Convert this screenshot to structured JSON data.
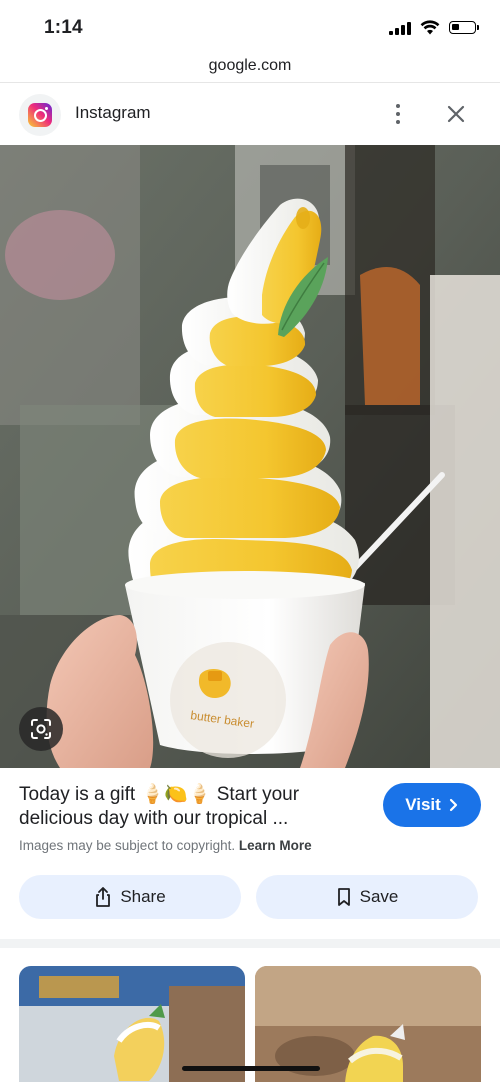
{
  "status_bar": {
    "time": "1:14",
    "battery_level": 0.35
  },
  "browser": {
    "url": "google.com"
  },
  "source": {
    "name": "Instagram",
    "logo_icon": "instagram-icon"
  },
  "result": {
    "title": "Today is a gift 🍦🍋🍦 Start your delicious day with our tropical ...",
    "visit_label": "Visit",
    "copyright_text": "Images may be subject to copyright.",
    "learn_more_label": "Learn More",
    "share_label": "Share",
    "save_label": "Save"
  },
  "image": {
    "cup_brand_text": "butter baker"
  },
  "colors": {
    "visit_button": "#1a73e8",
    "action_button_bg": "#e8f0fe",
    "soft_serve_yellow": "#f5c938"
  }
}
